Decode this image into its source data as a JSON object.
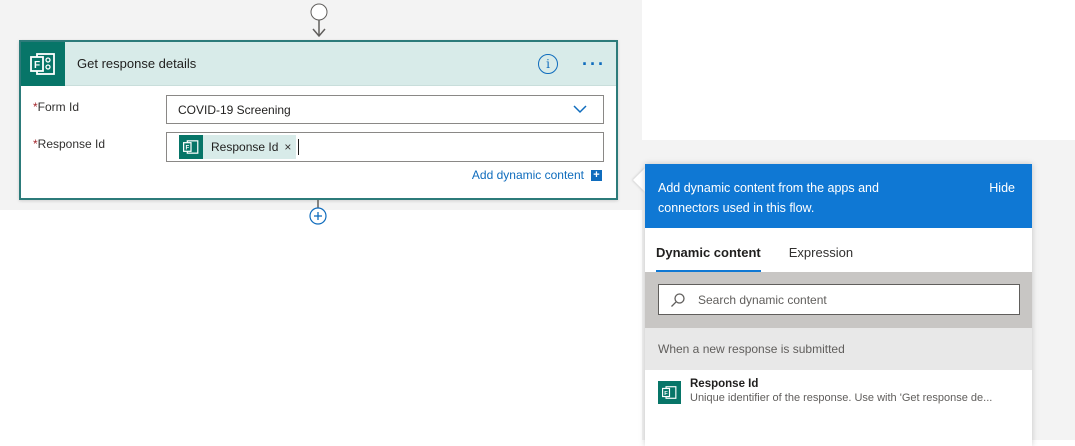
{
  "card": {
    "title": "Get response details",
    "info_icon": "info-icon",
    "more_icon": "more-icon",
    "form_id": {
      "required_mark": "*",
      "label": "Form Id",
      "value": "COVID-19 Screening"
    },
    "response_id": {
      "required_mark": "*",
      "label": "Response Id",
      "token_label": "Response Id",
      "token_remove": "×"
    },
    "add_dynamic_content": "Add dynamic content",
    "add_dynamic_plus": "+"
  },
  "panel": {
    "header_text": "Add dynamic content from the apps and connectors used in this flow.",
    "hide_label": "Hide",
    "tabs": [
      {
        "label": "Dynamic content",
        "active": true
      },
      {
        "label": "Expression",
        "active": false
      }
    ],
    "search_placeholder": "Search dynamic content",
    "section_title": "When a new response is submitted",
    "results": [
      {
        "title": "Response Id",
        "description": "Unique identifier of the response. Use with 'Get response de..."
      }
    ]
  },
  "colors": {
    "accent": "#0f78d4",
    "forms_green": "#077568",
    "card_border": "#2c7b7a",
    "header_bg": "#d8ebe9"
  }
}
